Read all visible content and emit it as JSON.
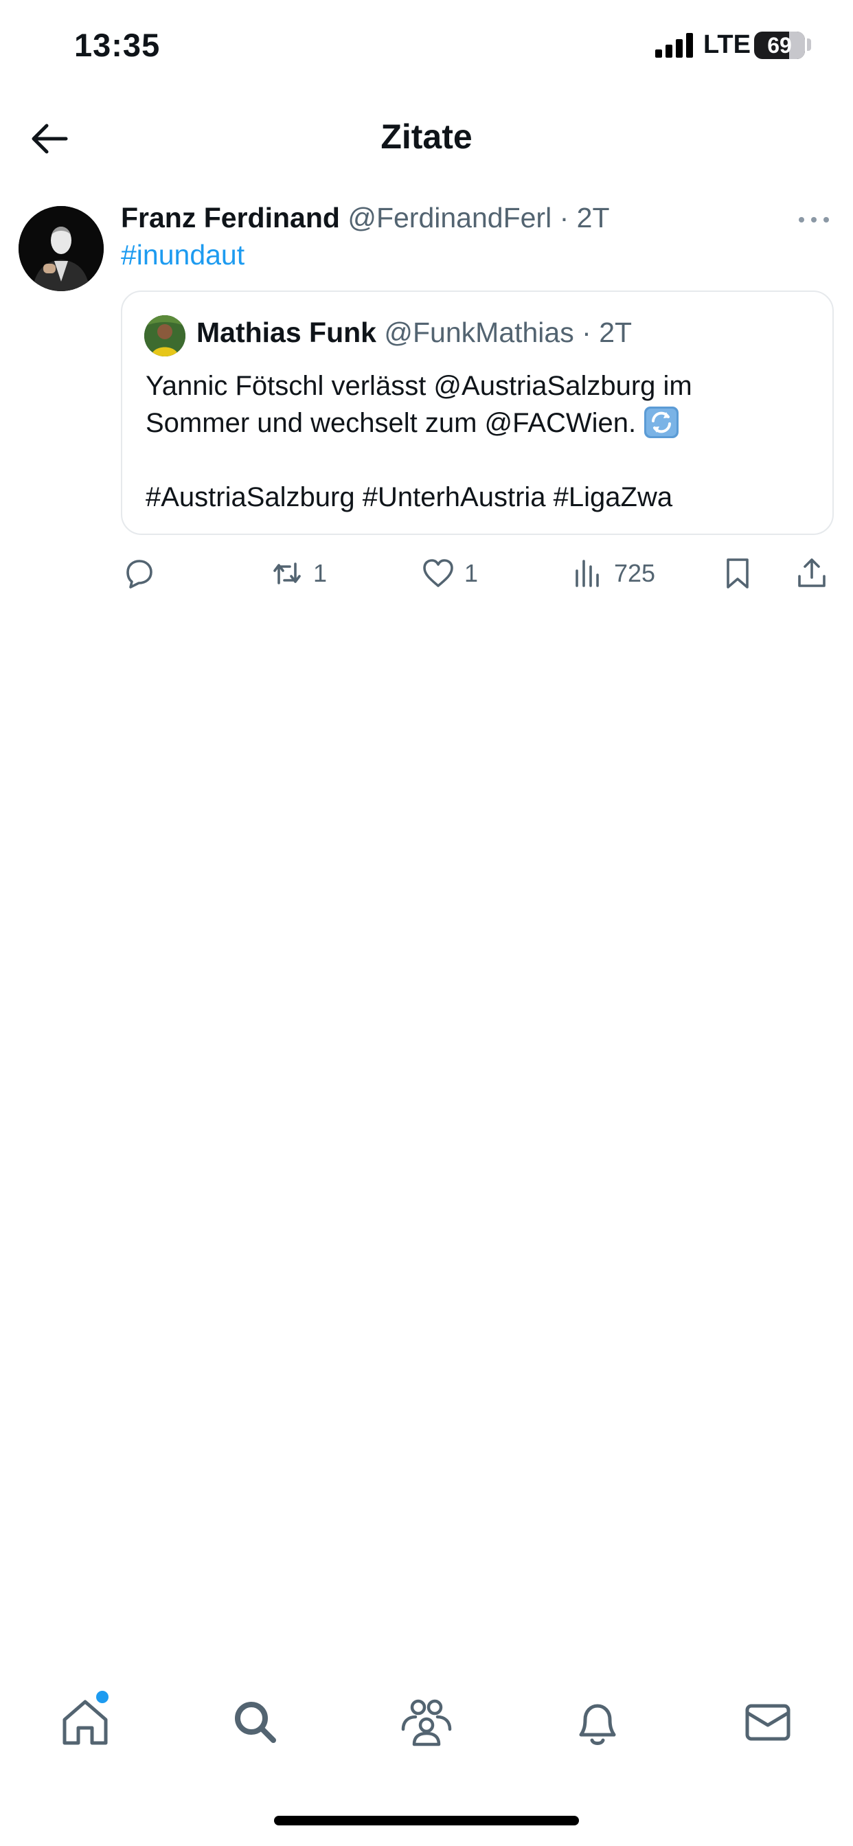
{
  "status_bar": {
    "time": "13:35",
    "network": "LTE",
    "battery": "69",
    "battery_level_percent": 69
  },
  "header": {
    "title": "Zitate",
    "back_icon": "arrow-left-icon"
  },
  "tweet": {
    "author_name": "Franz Ferdinand",
    "handle": "@FerdinandFerl",
    "separator": "·",
    "age": "2T",
    "text": "#inundaut",
    "more_icon": "more-horizontal-icon",
    "quoted": {
      "author_name": "Mathias Funk",
      "handle": "@FunkMathias",
      "separator": "·",
      "age": "2T",
      "line1": "Yannic Fötschl verlässt @AustriaSalzburg im",
      "line2": "Sommer und wechselt zum @FACWien.",
      "emoji_icon": "arrows-counterclockwise-emoji-icon",
      "line3": "#AustriaSalzburg #UnterhAustria #LigaZwa"
    },
    "actions": {
      "reply_count": "",
      "retweet_count": "1",
      "like_count": "1",
      "views_count": "725"
    }
  },
  "tabs": [
    "home-icon",
    "search-icon",
    "communities-icon",
    "notifications-icon",
    "messages-icon"
  ],
  "colors": {
    "accent": "#1d9bf0",
    "text_primary": "#0f1419",
    "text_secondary": "#536471",
    "border": "#e6e9ec"
  }
}
